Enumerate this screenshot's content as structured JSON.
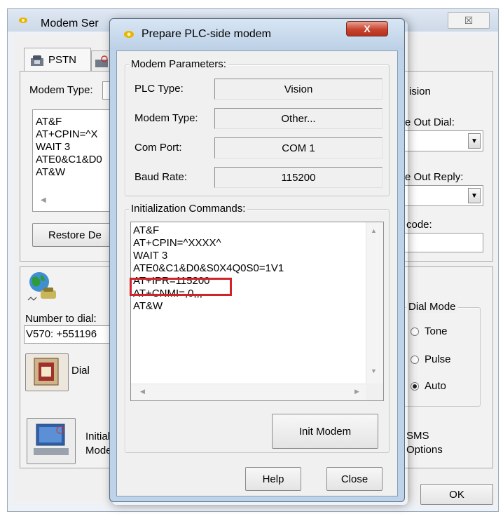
{
  "back_window": {
    "title": "Modem Ser",
    "close_glyph": "☒",
    "tabs": [
      {
        "label": "PSTN"
      },
      {
        "label": ""
      }
    ],
    "modem_type_label": "Modem Type:",
    "init_lines": [
      "AT&F",
      "AT+CPIN=^X",
      "WAIT 3",
      "ATE0&C1&D0",
      "AT&W"
    ],
    "restore_label": "Restore De",
    "right": {
      "vision_label": "ision",
      "out_dial_label": "e Out Dial:",
      "out_reply_label": "e Out Reply:",
      "code_label": "code:"
    },
    "number_to_dial_label": "Number to dial:",
    "number_to_dial_value": "V570: +551196",
    "dial_label": "Dial",
    "dial_mode": {
      "title": "Dial Mode",
      "options": [
        {
          "label": "Tone",
          "selected": false
        },
        {
          "label": "Pulse",
          "selected": false
        },
        {
          "label": "Auto",
          "selected": true
        }
      ]
    },
    "init_modem_label_1": "Initiali",
    "init_modem_label_2": "Mode",
    "sms_label_1": "SMS",
    "sms_label_2": "Options",
    "ok_label": "OK"
  },
  "dialog": {
    "title": "Prepare PLC-side modem",
    "close_glyph": "X",
    "modem_parameters": {
      "legend": "Modem Parameters:",
      "rows": [
        {
          "label": "PLC Type:",
          "value": "Vision"
        },
        {
          "label": "Modem Type:",
          "value": "Other..."
        },
        {
          "label": "Com Port:",
          "value": "COM 1"
        },
        {
          "label": "Baud Rate:",
          "value": "115200"
        }
      ]
    },
    "init_commands": {
      "legend": "Initialization Commands:",
      "lines": [
        "AT&F",
        "AT+CPIN=^XXXX^",
        "WAIT 3",
        "ATE0&C1&D0&S0X4Q0S0=1V1",
        "AT+IPR=115200",
        "AT+CNMI=,0,,,",
        "AT&W"
      ],
      "highlighted_line": "AT+IPR=115200",
      "highlight_color": "#d0242c"
    },
    "init_modem_button": "Init Modem",
    "help_button": "Help",
    "close_button": "Close"
  }
}
